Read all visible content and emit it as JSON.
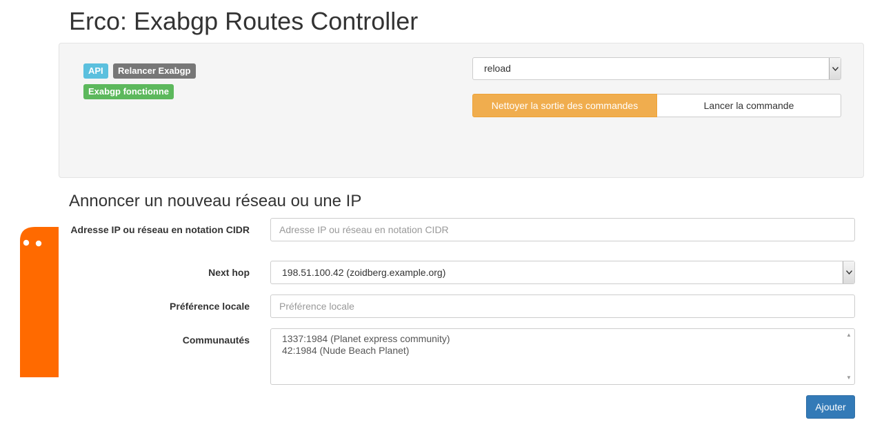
{
  "header": {
    "title": "Erco: Exabgp Routes Controller"
  },
  "status": {
    "api_label": "API",
    "reload_label": "Relancer Exabgp",
    "running_label": "Exabgp fonctionne"
  },
  "command": {
    "selected": "reload",
    "clear_output_label": "Nettoyer la sortie des commandes",
    "run_label": "Lancer la commande"
  },
  "announce": {
    "heading": "Annoncer un nouveau réseau ou une IP",
    "ip_label": "Adresse IP ou réseau en notation CIDR",
    "ip_placeholder": "Adresse IP ou réseau en notation CIDR",
    "nexthop_label": "Next hop",
    "nexthop_selected": "198.51.100.42 (zoidberg.example.org)",
    "localpref_label": "Préférence locale",
    "localpref_placeholder": "Préférence locale",
    "communities_label": "Communautés",
    "communities": [
      "1337:1984 (Planet express community)",
      "42:1984 (Nude Beach Planet)"
    ],
    "submit_label": "Ajouter"
  },
  "colors": {
    "info": "#5bc0de",
    "default": "#777777",
    "success": "#5cb85c",
    "warning": "#f0ad4e",
    "primary": "#337ab7",
    "mascot": "#ff6a00"
  },
  "icons": [
    "chevron-down-icon",
    "scroll-up-icon",
    "scroll-down-icon",
    "mascot-icon"
  ]
}
